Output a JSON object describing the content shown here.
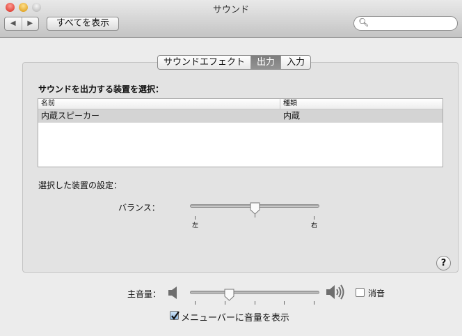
{
  "window": {
    "title": "サウンド"
  },
  "toolbar": {
    "back": "◀",
    "forward": "▶",
    "show_all": "すべてを表示",
    "search_placeholder": ""
  },
  "tabs": [
    {
      "label": "サウンドエフェクト"
    },
    {
      "label": "出力",
      "active": true
    },
    {
      "label": "入力"
    }
  ],
  "output": {
    "heading": "サウンドを出力する装置を選択：",
    "columns": [
      "名前",
      "種類"
    ],
    "rows": [
      {
        "name": "内蔵スピーカー",
        "type": "内蔵",
        "selected": true
      }
    ],
    "settings_heading": "選択した装置の設定：",
    "balance_label": "バランス：",
    "balance_left": "左",
    "balance_right": "右",
    "balance_value": 0.5
  },
  "volume": {
    "label": "主音量：",
    "value": 0.29,
    "mute_label": "消音",
    "mute_checked": false,
    "show_in_menubar_label": "メニューバーに音量を表示",
    "show_in_menubar_checked": true
  },
  "help": "?"
}
